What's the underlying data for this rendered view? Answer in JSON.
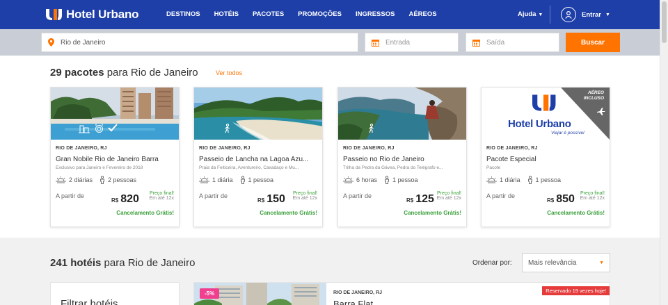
{
  "header": {
    "brand": "Hotel Urbano",
    "nav": [
      "DESTINOS",
      "HOTÉIS",
      "PACOTES",
      "PROMOÇÕES",
      "INGRESSOS",
      "AÉREOS"
    ],
    "help_label": "Ajuda",
    "login_label": "Entrar"
  },
  "search": {
    "destination_value": "Rio de Janeiro",
    "checkin_placeholder": "Entrada",
    "checkout_placeholder": "Saída",
    "button_label": "Buscar"
  },
  "packages": {
    "title_count": "29 pacotes",
    "title_rest": " para Rio de Janeiro",
    "see_all": "Ver todos",
    "from_label": "A partir de",
    "currency": "R$",
    "final_price_label": "Preço final!",
    "cancel_label": "Cancelamento Grátis!",
    "items": [
      {
        "location": "RIO DE JANEIRO, RJ",
        "title": "Gran Nobile Rio de Janeiro Barra",
        "subtitle": "Exclusivo para Janeiro e Fevereiro de 2018",
        "duration": "2 diárias",
        "people": "2 pessoas",
        "price": "820",
        "installments": "Em até 12x"
      },
      {
        "location": "RIO DE JANEIRO, RJ",
        "title": "Passeio de Lancha na Lagoa Azu...",
        "subtitle": "Praia da Feiticeira, Aventureiro, Caxadaço e Mu...",
        "duration": "1 diária",
        "people": "1 pessoa",
        "price": "150",
        "installments": "Em até 12x"
      },
      {
        "location": "RIO DE JANEIRO, RJ",
        "title": "Passeio no Rio de Janeiro",
        "subtitle": "Trilha da Pedra da Gávea, Pedra do Telégrafo e...",
        "duration": "6 horas",
        "people": "1 pessoa",
        "price": "125",
        "installments": "Em até 12x"
      },
      {
        "location": "RIO DE JANEIRO, RJ",
        "title": "Pacote Especial",
        "subtitle": "Pacote",
        "duration": "1 diária",
        "people": "1 pessoa",
        "price": "850",
        "installments": "Em até 12x",
        "ribbon_line1": "AÉREO",
        "ribbon_line2": "INCLUSO",
        "logo_tagline": "Viajar é possível"
      }
    ]
  },
  "hotels": {
    "title_count": "241 hotéis",
    "title_rest": " para Rio de Janeiro",
    "sort_label": "Ordenar por:",
    "sort_value": "Mais relevância",
    "filter_title": "Filtrar hotéis",
    "first": {
      "discount": "-5%",
      "location": "RIO DE JANEIRO, RJ",
      "name": "Barra Flat",
      "reserved": "Reservado 19 vezes hoje!"
    }
  },
  "colors": {
    "header_blue": "#1e3fa8",
    "accent_orange": "#ff7300",
    "success_green": "#3aa03a",
    "discount_pink": "#ef3f8e",
    "alert_red": "#e63b3b"
  }
}
